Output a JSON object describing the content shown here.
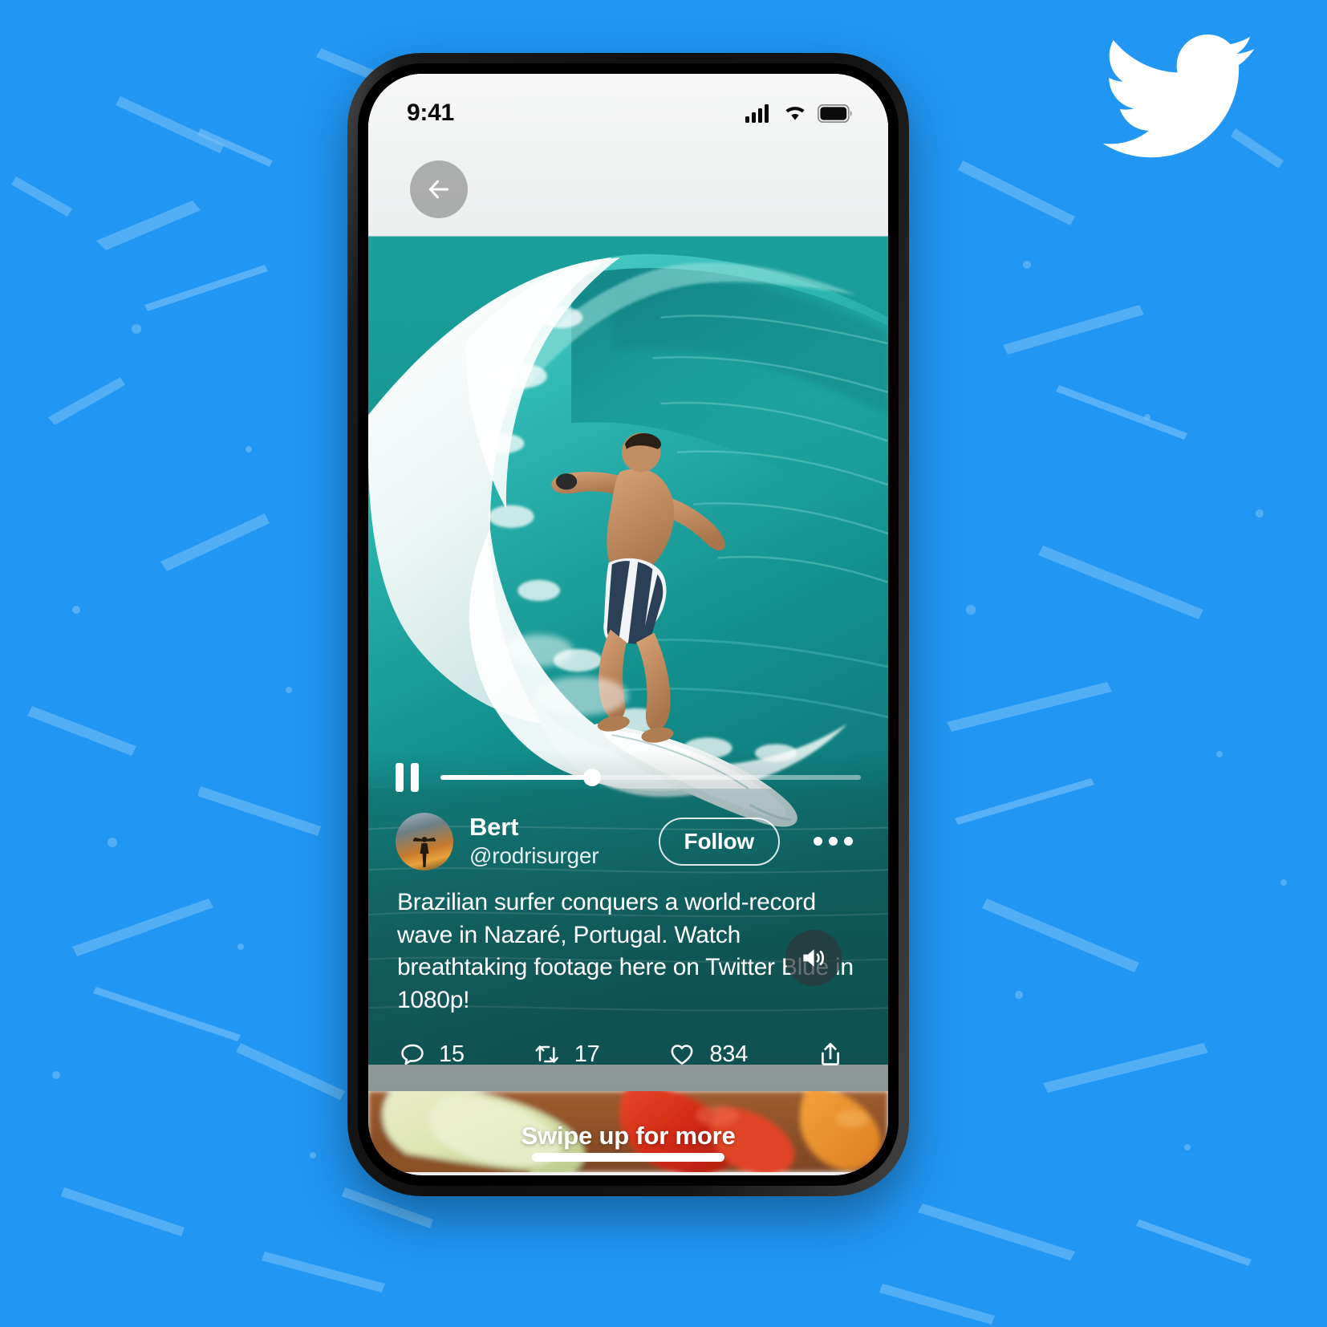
{
  "theme": {
    "brand_blue": "#2196F3",
    "accent_white": "#FFFFFF",
    "overlay_tint": "#162A2C"
  },
  "brand": {
    "logo_icon": "twitter-bird-icon",
    "logo_color": "#FFFFFF"
  },
  "status_bar": {
    "time": "9:41",
    "cellular_icon": "signal-bars-icon",
    "wifi_icon": "wifi-icon",
    "battery_icon": "battery-full-icon"
  },
  "nav": {
    "back_icon": "arrow-left-icon"
  },
  "player": {
    "pause_icon": "pause-icon",
    "volume_icon": "speaker-on-icon",
    "progress_percent": 36
  },
  "tweet": {
    "author_name": "Bert",
    "author_handle": "@rodrisurger",
    "avatar_icon": "avatar-surfer-sunset",
    "follow_label": "Follow",
    "more_icon": "more-horizontal-icon",
    "text": "Brazilian surfer conquers a world-record wave in Nazaré, Portugal. Watch breathtaking footage here on Twitter Blue in 1080p!",
    "actions": [
      {
        "icon": "reply-icon",
        "name": "reply",
        "count": "15"
      },
      {
        "icon": "retweet-icon",
        "name": "retweet",
        "count": "17"
      },
      {
        "icon": "like-icon",
        "name": "like",
        "count": "834"
      },
      {
        "icon": "share-icon",
        "name": "share",
        "count": ""
      }
    ]
  },
  "next_video": {
    "swipe_label": "Swipe up for more"
  },
  "system": {
    "home_indicator": "home-indicator-bar"
  }
}
